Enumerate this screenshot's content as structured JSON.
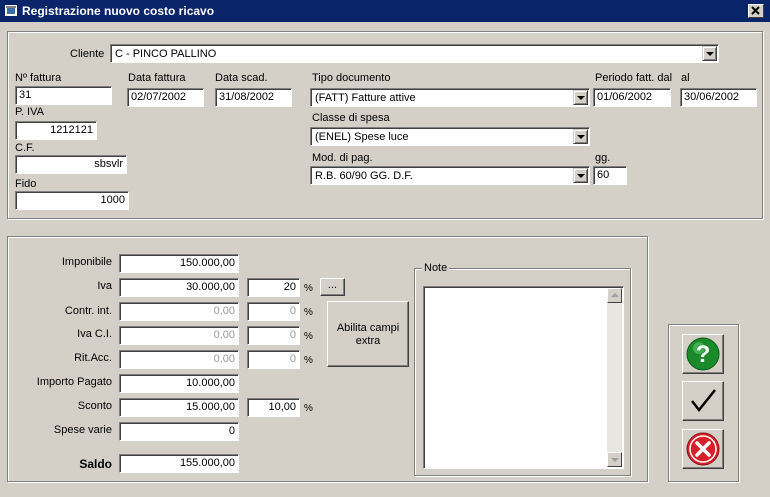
{
  "window": {
    "title": "Registrazione nuovo costo ricavo",
    "close_label": "x"
  },
  "header": {
    "cliente_label": "Cliente",
    "cliente_value": "C - PINCO PALLINO",
    "fattura_label": "Nº fattura",
    "fattura_value": "31",
    "data_fattura_label": "Data fattura",
    "data_fattura_value": "02/07/2002",
    "data_scad_label": "Data scad.",
    "data_scad_value": "31/08/2002",
    "piva_label": "P. IVA",
    "piva_value": "1212121",
    "cf_label": "C.F.",
    "cf_value": "sbsvlr",
    "fido_label": "Fido",
    "fido_value": "1000",
    "tipo_doc_label": "Tipo documento",
    "tipo_doc_value": "(FATT) Fatture attive",
    "classe_label": "Classe di spesa",
    "classe_value": "(ENEL) Spese luce",
    "mod_pag_label": "Mod. di pag.",
    "mod_pag_value": "R.B. 60/90 GG. D.F.",
    "periodo_label": "Periodo fatt. dal",
    "periodo_dal_value": "01/06/2002",
    "al_label": "al",
    "periodo_al_value": "30/06/2002",
    "gg_label": "gg.",
    "gg_value": "60"
  },
  "amounts": {
    "imponibile_label": "Imponibile",
    "imponibile_value": "150.000,00",
    "iva_label": "Iva",
    "iva_value": "30.000,00",
    "iva_pct": "20",
    "contr_label": "Contr. int.",
    "contr_value": "0,00",
    "contr_pct": "0",
    "ivaci_label": "Iva C.I.",
    "ivaci_value": "0,00",
    "ivaci_pct": "0",
    "ritacc_label": "Rit.Acc.",
    "ritacc_value": "0,00",
    "ritacc_pct": "0",
    "importo_label": "Importo Pagato",
    "importo_value": "10.000,00",
    "sconto_label": "Sconto",
    "sconto_value": "15.000,00",
    "sconto_pct": "10,00",
    "spese_label": "Spese varie",
    "spese_value": "0",
    "saldo_label": "Saldo",
    "saldo_value": "155.000,00",
    "percent_sign": "%",
    "ellipsis_label": "...",
    "abilita_label": "Abilita campi extra",
    "note_label": "Note"
  },
  "icons": {
    "help": "help-icon",
    "confirm": "checkmark-icon",
    "cancel": "cancel-icon"
  },
  "colors": {
    "titlebar": "#0a246a",
    "help_green": "#1a8a2a",
    "cancel_red": "#d8202a"
  }
}
